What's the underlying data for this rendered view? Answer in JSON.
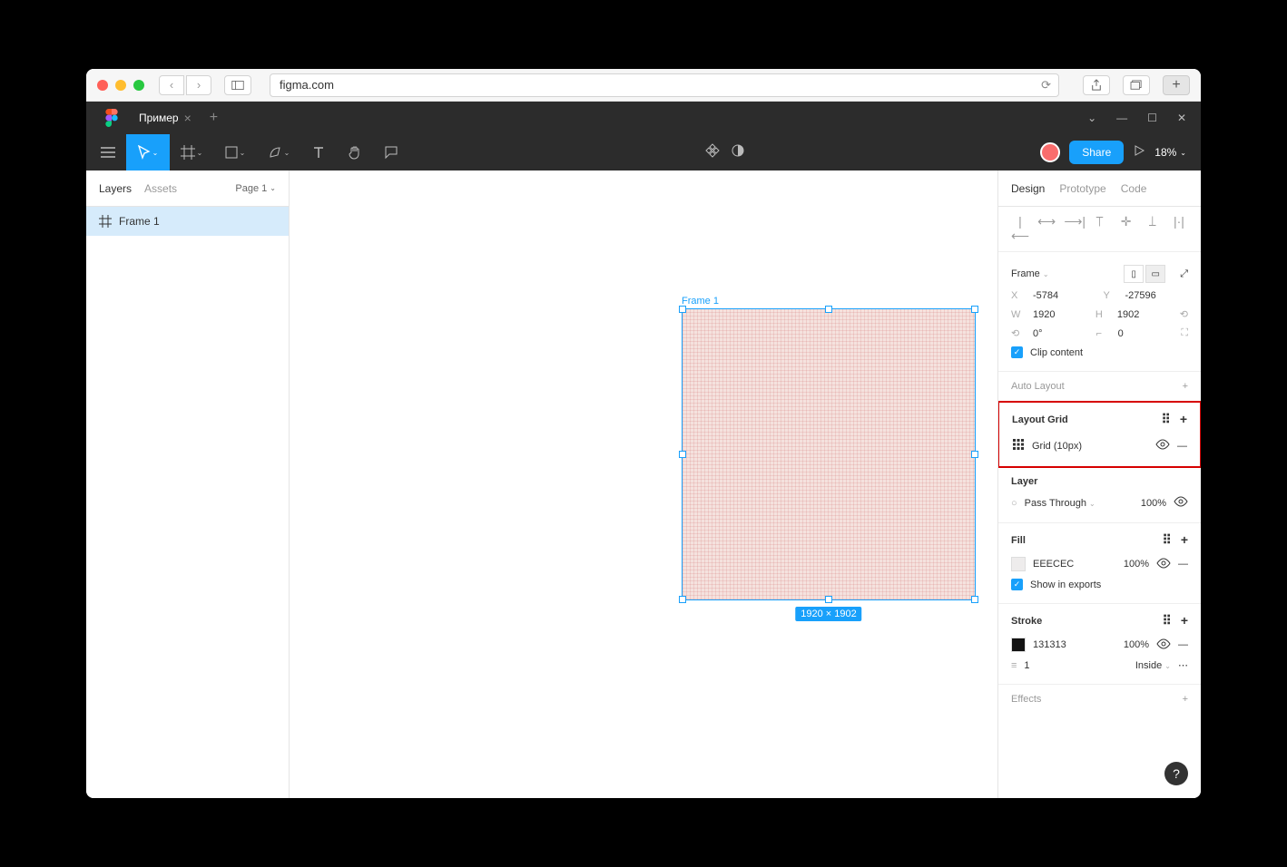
{
  "browser": {
    "url": "figma.com"
  },
  "tabs": {
    "active": "Пример"
  },
  "toolbar": {
    "share": "Share",
    "zoom": "18%"
  },
  "leftPanel": {
    "tabs": {
      "layers": "Layers",
      "assets": "Assets"
    },
    "page": "Page 1",
    "layer": "Frame 1"
  },
  "canvas": {
    "frameLabel": "Frame 1",
    "sizeChip": "1920 × 1902"
  },
  "rightPanel": {
    "tabs": {
      "design": "Design",
      "prototype": "Prototype",
      "code": "Code"
    },
    "frame": {
      "label": "Frame",
      "x": "-5784",
      "xLabel": "X",
      "y": "-27596",
      "yLabel": "Y",
      "w": "1920",
      "wLabel": "W",
      "h": "1902",
      "hLabel": "H",
      "rotation": "0°",
      "radius": "0",
      "clip": "Clip content"
    },
    "autoLayout": "Auto Layout",
    "layoutGrid": {
      "title": "Layout Grid",
      "item": "Grid (10px)"
    },
    "layer": {
      "title": "Layer",
      "mode": "Pass Through",
      "opacity": "100%"
    },
    "fill": {
      "title": "Fill",
      "color": "EEECEC",
      "opacity": "100%",
      "showInExports": "Show in exports"
    },
    "stroke": {
      "title": "Stroke",
      "color": "131313",
      "opacity": "100%",
      "weight": "1",
      "position": "Inside"
    },
    "effects": "Effects"
  }
}
